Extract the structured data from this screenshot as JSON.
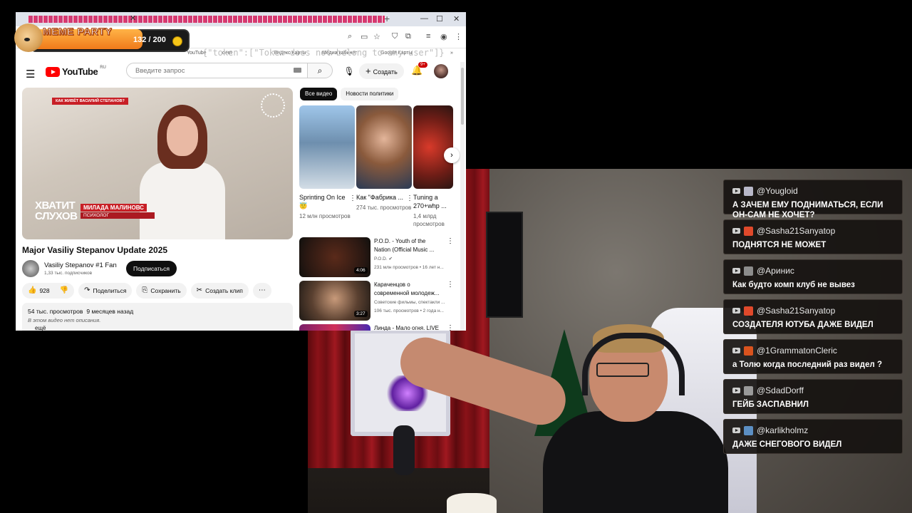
{
  "browser": {
    "bookmarks": [
      "YouTube",
      "dem",
      "Яндекс Карты",
      "Медиа кабинет",
      "Google Карты"
    ],
    "token_text": "{\"token\":[\"Token does not belong to any user\"]}"
  },
  "youtube": {
    "logo": "YouTube",
    "region": "RU",
    "search_placeholder": "Введите запрос",
    "create_label": "Создать",
    "notifications_badge": "9+",
    "player": {
      "banner": "КАК ЖИВЁТ ВАСИЛИЙ СТЕПАНОВ?",
      "show_title": "ХВАТИТ СЛУХОВ",
      "guest_name": "МИЛАДА МАЛИНОВС",
      "guest_role": "ПСИХОЛОГ"
    },
    "video_title": "Major Vasiliy Stepanov Update 2025",
    "channel_name": "Vasiliy Stepanov #1 Fan",
    "channel_subs": "1,33 тыс. подписчиков",
    "subscribe_label": "Подписаться",
    "likes": "928",
    "share_label": "Поделиться",
    "save_label": "Сохранить",
    "clip_label": "Создать клип",
    "views": "54 тыс. просмотров",
    "date": "9 месяцев назад",
    "description": "В этом видео нет описания.",
    "more_label": "ещё",
    "chips": [
      "Все видео",
      "Новости политики"
    ],
    "shorts": [
      {
        "title": "Sprinting On Ice 😇",
        "views": "12 млн просмотров"
      },
      {
        "title": "Как \"Фабрика ...",
        "views": "274 тыс. просмотров"
      },
      {
        "title": "Tuning a 270+whp ...",
        "views": "1,4 млрд просмотров"
      }
    ],
    "recommendations": [
      {
        "title": "P.O.D. - Youth of the Nation (Official Music ...",
        "meta": "P.O.D. ✔",
        "meta2": "231 млн просмотров • 16 лет н...",
        "duration": "4:06"
      },
      {
        "title": "Караченцов о современной молодеж...",
        "meta": "Советские фильмы, спектакли ...",
        "meta2": "106 тыс. просмотров • 2 года н...",
        "duration": "3:27"
      },
      {
        "title": "Линда - Мало огня. LIVE",
        "meta": "",
        "meta2": "",
        "duration": ""
      }
    ]
  },
  "overlay": {
    "title": "MEME PARTY",
    "score": "132 / 200"
  },
  "chat": [
    {
      "user": "@Yougloid",
      "text": "А ЗАЧЕМ ЕМУ ПОДНИМАТЬСЯ, ЕСЛИ ОН-САМ НЕ ХОЧЕТ?",
      "avatar_color": "#b8b8c8"
    },
    {
      "user": "@Sasha21Sanyatop",
      "text": "ПОДНЯТСЯ НЕ МОЖЕТ",
      "avatar_color": "#e0492b"
    },
    {
      "user": "@Аринис",
      "text": "Как будто комп клуб не вывез",
      "avatar_color": "#8c8c8c"
    },
    {
      "user": "@Sasha21Sanyatop",
      "text": "СОЗДАТЕЛЯ ЮТУБА ДАЖЕ ВИДЕЛ",
      "avatar_color": "#e0492b"
    },
    {
      "user": "@1GrammatonCleric",
      "text": "а Толю когда последний раз видел ?",
      "avatar_color": "#d9531e"
    },
    {
      "user": "@SdadDorff",
      "text": "ГЕЙБ ЗАСПАВНИЛ",
      "avatar_color": "#9a9a9a"
    },
    {
      "user": "@karlikholmz",
      "text": "ДАЖЕ СНЕГОВОГО ВИДЕЛ",
      "avatar_color": "#5c8fc4"
    }
  ]
}
